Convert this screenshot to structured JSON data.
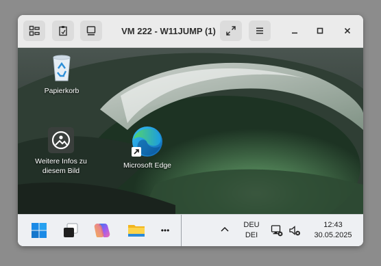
{
  "window": {
    "title": "VM 222 - W11JUMP (1)"
  },
  "toolbar": {
    "left_buttons": [
      "connection-icon",
      "clipboard-icon",
      "display-icon"
    ],
    "right_buttons": [
      "fullscreen-icon",
      "menu-icon"
    ],
    "window_controls": [
      "minimize-icon",
      "maximize-icon",
      "close-icon"
    ]
  },
  "desktop": {
    "icons": [
      {
        "label": "Papierkorb",
        "icon": "recycle-bin-icon"
      },
      {
        "label_line1": "Weitere Infos zu",
        "label_line2": "diesem Bild",
        "icon": "learn-about-picture-icon"
      },
      {
        "label": "Microsoft Edge",
        "icon": "edge-icon"
      }
    ]
  },
  "taskbar": {
    "apps": [
      "start-icon",
      "task-view-icon",
      "copilot-icon",
      "file-explorer-icon",
      "more-icon"
    ],
    "more_label": "•••",
    "tray": {
      "chevron": "^",
      "lang_line1": "DEU",
      "lang_line2": "DEI",
      "time": "12:43",
      "date": "30.05.2025"
    }
  },
  "colors": {
    "headerbar": "#ebebeb",
    "taskbar": "#eef0f3",
    "wave_dark": "#1e2a22",
    "wave_green": "#3e6a45"
  }
}
